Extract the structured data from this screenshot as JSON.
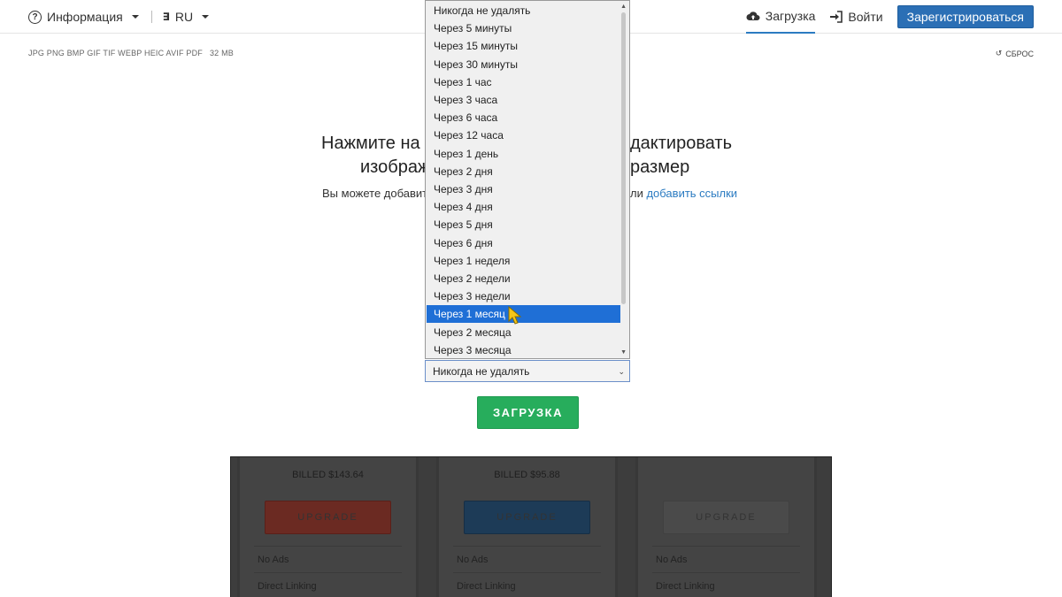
{
  "nav": {
    "info_label": "Информация",
    "lang_label": "RU",
    "upload_label": "Загрузка",
    "login_label": "Войти",
    "register_label": "Зарегистрироваться"
  },
  "formats": {
    "list": "JPG PNG BMP GIF TIF WEBP HEIC AVIF PDF",
    "size": "32 MB",
    "reset_label": "СБРОС"
  },
  "main": {
    "headline_a1": "Нажмите на",
    "headline_a2": "дактировать",
    "headline_b1": "изображ",
    "headline_b2": "размер",
    "sub_left": "Вы можете добавит",
    "sub_right": "ли ",
    "sub_link": "добавить ссылки"
  },
  "expiry_select": {
    "selected_value": "Никогда не удалять",
    "highlighted": "Через 1 месяц",
    "options": [
      "Никогда не удалять",
      "Через 5 минуты",
      "Через 15 минуты",
      "Через 30 минуты",
      "Через 1 час",
      "Через 3 часа",
      "Через 6 часа",
      "Через 12 часа",
      "Через 1 день",
      "Через 2 дня",
      "Через 3 дня",
      "Через 4 дня",
      "Через 5 дня",
      "Через 6 дня",
      "Через 1 неделя",
      "Через 2 недели",
      "Через 3 недели",
      "Через 1 месяц",
      "Через 2 месяца",
      "Через 3 месяца"
    ]
  },
  "upload_button_label": "ЗАГРУЗКА",
  "pricing": {
    "plans": [
      {
        "billed": "BILLED $143.64",
        "upgrade": "UPGRADE",
        "color": "#6b2a22",
        "features": [
          "No Ads",
          "Direct Linking"
        ]
      },
      {
        "billed": "BILLED $95.88",
        "upgrade": "UPGRADE",
        "color": "#1d3b57",
        "features": [
          "No Ads",
          "Direct Linking"
        ]
      },
      {
        "billed": "",
        "upgrade": "UPGRADE",
        "color": "#4a4a4a",
        "features": [
          "No Ads",
          "Direct Linking"
        ]
      }
    ]
  },
  "colors": {
    "accent_blue": "#2b6fb5",
    "upload_green": "#27ad5c",
    "selection_blue": "#1f6fd6"
  }
}
